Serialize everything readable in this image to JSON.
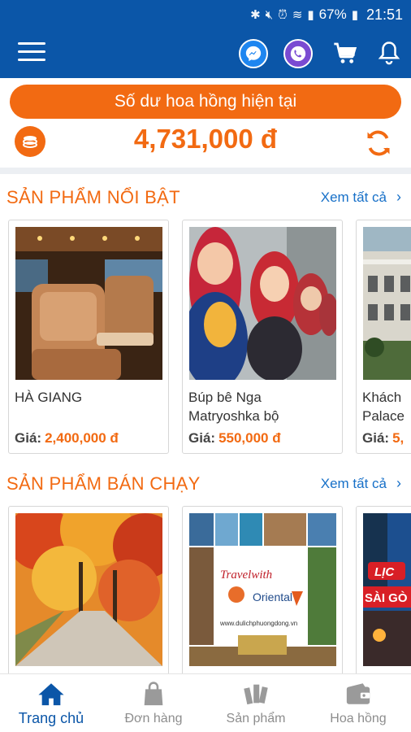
{
  "status_bar": {
    "battery": "67%",
    "time": "21:51"
  },
  "app_bar": {
    "icons": [
      "menu-icon",
      "messenger-icon",
      "viber-icon",
      "cart-icon",
      "bell-icon"
    ]
  },
  "balance": {
    "label": "Số dư hoa hồng hiện tại",
    "amount": "4,731,000 đ"
  },
  "featured": {
    "title": "SẢN PHẨM NỔI BẬT",
    "see_all": "Xem tất cả",
    "items": [
      {
        "name": "HÀ GIANG",
        "price_label": "Giá:",
        "price": "2,400,000 đ"
      },
      {
        "name": "Búp bê Nga\nMatryoshka bộ",
        "price_label": "Giá:",
        "price": "550,000 đ"
      },
      {
        "name": "Khách\nPalace",
        "price_label": "Giá:",
        "price": "5,"
      }
    ]
  },
  "best_selling": {
    "title": "SẢN PHẨM BÁN CHẠY",
    "see_all": "Xem tất cả",
    "items": [
      {
        "name": ""
      },
      {
        "name": "",
        "image_text": [
          "Travelwith",
          "Oriental",
          "www.dulichphuongdong.vn"
        ]
      },
      {
        "name": "",
        "image_text": [
          "LỊC",
          "SÀI GÒ"
        ]
      }
    ]
  },
  "bottom_nav": [
    {
      "label": "Trang chủ",
      "active": true
    },
    {
      "label": "Đơn hàng",
      "active": false
    },
    {
      "label": "Sản phẩm",
      "active": false
    },
    {
      "label": "Hoa hồng",
      "active": false
    }
  ],
  "colors": {
    "primary": "#0b56a8",
    "accent": "#f26a12",
    "link": "#1770c8"
  }
}
